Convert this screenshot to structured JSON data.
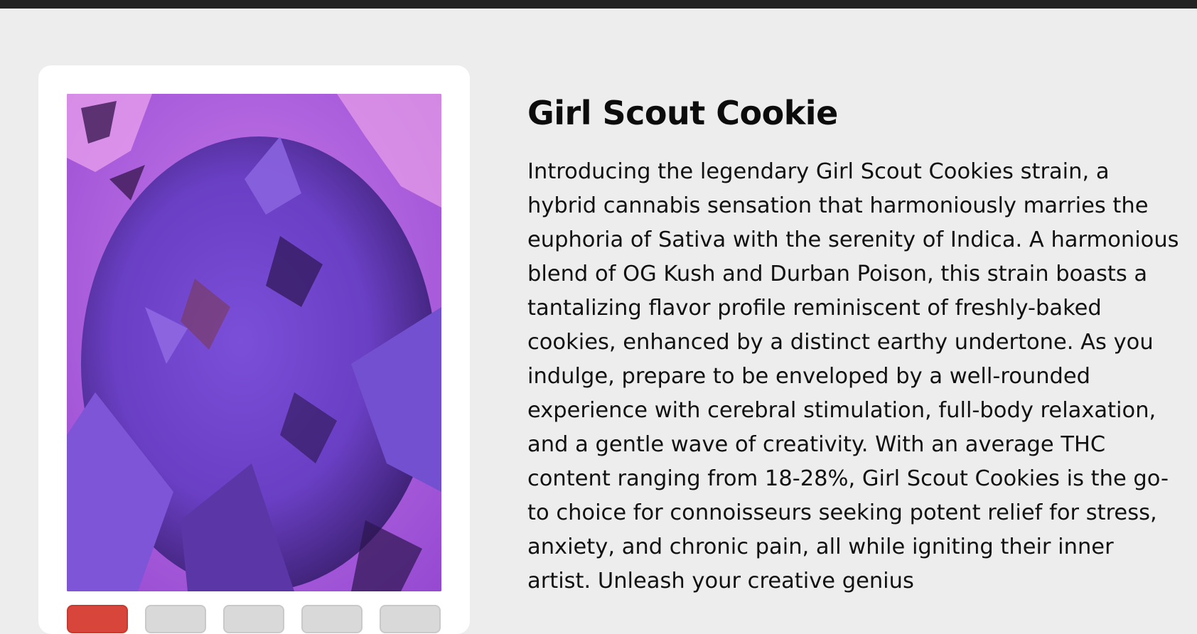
{
  "product": {
    "name": "Girl Scout Cookie",
    "description": "Introducing the legendary Girl Scout Cookies strain, a hybrid cannabis sensation that harmoniously marries the euphoria of Sativa with the serenity of Indica. A harmonious blend of OG Kush and Durban Poison, this strain boasts a tantalizing flavor profile reminiscent of freshly-baked cookies, enhanced by a distinct earthy undertone. As you indulge, prepare to be enveloped by a well-rounded experience with cerebral stimulation, full-body relaxation, and a gentle wave of creativity. With an average THC content ranging from 18-28%, Girl Scout Cookies is the go-to choice for connoisseurs seeking potent relief for stress, anxiety, and chronic pain, all while igniting their inner artist. Unleash your creative genius",
    "image_alt": "purple cannabis bud under grow light"
  },
  "gallery": {
    "thumbnail_count": 5,
    "active_index": 0
  },
  "colors": {
    "accent": "#d8453a",
    "page_background": "#ededed",
    "topbar": "#232323"
  }
}
